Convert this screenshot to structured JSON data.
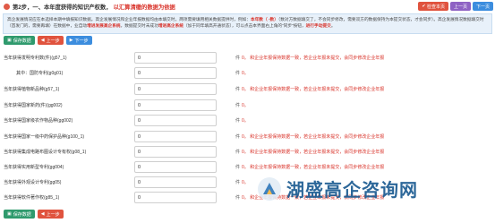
{
  "header": {
    "step_title": "第2步，一、本年度获得的知识产权数，",
    "step_hint": "以汇算清缴的数据为依据",
    "actions": {
      "check": "检查本页",
      "previous": "上一页",
      "next": "下一页"
    }
  },
  "notice": {
    "p1": "高企发展情况应在本选择本期中填报知识数据。高企发展情况和企业年报数据均由本填交时，两项需要填用相关数据提供时，例如：",
    "red1": "本年数（ -数）",
    "p2": "（数对方数据填交了，不会同步修改，需要双方的数据保持为本提交状态，才会同步）。高企发展情况数据填交时（首发门的，需要再填）在数据中，",
    "p3": "业自动",
    "red2": "增进发展高企系统",
    "p4": "，数据提交时未成功",
    "red3": "增进高企系统",
    "p5": "（加于同年填高开通状态），可以点击本界面右上角的“同步”按钮，",
    "red4": "进行手动提交",
    "p6": "。"
  },
  "buttons": {
    "save": "保存数据",
    "prev": "上一步",
    "next": "下一步",
    "save_bottom": "保存数据",
    "prev_bottom": "上一步"
  },
  "fields": [
    {
      "label": "当年获得发明专利数(件)(g57_1)",
      "value": "0",
      "unit": "件",
      "hint": "0。 和企业年报保持数据一致，若企业年报未提交，会同步修改企业年报"
    },
    {
      "label": "其中：国防专利(g0g01)",
      "value": "0",
      "unit": "件",
      "hint": "0。"
    },
    {
      "label": "当年获得植物新品种(g57_1)",
      "value": "0",
      "unit": "件",
      "hint": "0。 和企业年报保持数据一致，若企业年报未提交，会同步修改企业年报"
    },
    {
      "label": "当年获得国家新药(件)(gg002)",
      "value": "0",
      "unit": "件",
      "hint": "0。"
    },
    {
      "label": "当年获得国家级农作物品种(gg002)",
      "value": "0",
      "unit": "件",
      "hint": "0。"
    },
    {
      "label": "当年获得国家一级中药保护品种(g100_1)",
      "value": "0",
      "unit": "件",
      "hint": "0。 和企业年报保持数据一致，若企业年报未提交，会同步修改企业年报"
    },
    {
      "label": "当年获得集成电路布图设计专有权(g08_1)",
      "value": "0",
      "unit": "件",
      "hint": "0。 和企业年报保持数据一致，若企业年报未提交，会同步修改企业年报"
    },
    {
      "label": "当年获得实用新型专利(gg004)",
      "value": "0",
      "unit": "件",
      "hint": "0。 和企业年报保持数据一致，若企业年报未提交，会同步修改企业年报"
    },
    {
      "label": "当年获得外观设计专利(gg05)",
      "value": "0",
      "unit": "件",
      "hint": "0。"
    },
    {
      "label": "当年获得软件著作权(g85_1)",
      "value": "0",
      "unit": "件",
      "hint": "0。 和企业年报保持数据一致，若企业年报未提交，会同步修改企业年报"
    }
  ],
  "watermark": {
    "text": "湖盛高企咨询网"
  }
}
